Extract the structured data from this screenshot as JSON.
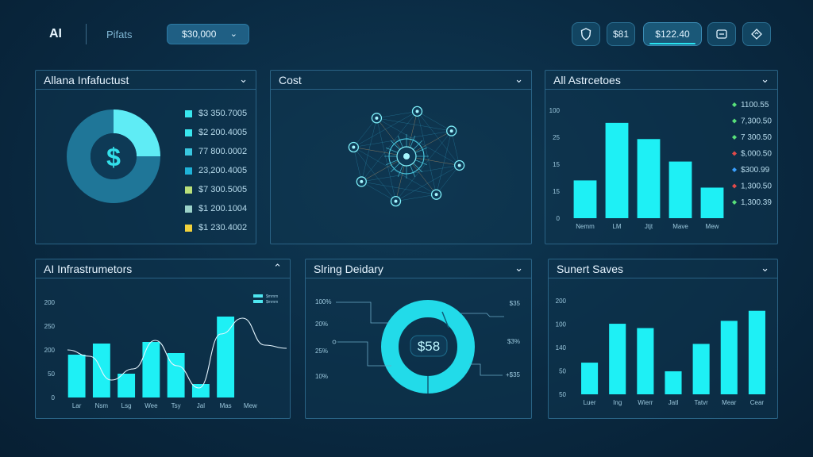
{
  "header": {
    "logo": "AI",
    "nav_label": "Pifats",
    "select_value": "$30,000",
    "buttons": [
      "$81",
      "$122.40"
    ],
    "icons": [
      "shield-icon",
      "card-icon",
      "navigation-icon"
    ]
  },
  "panels": {
    "infra": {
      "title": "Allana Infafuctust",
      "center_symbol": "$",
      "legend": [
        {
          "label": "$3 350.7005",
          "color": "#39e6ee"
        },
        {
          "label": "$2 200.4005",
          "color": "#39e6ee"
        },
        {
          "label": "77 800.0002",
          "color": "#39c7e0"
        },
        {
          "label": "23,200.4005",
          "color": "#1fb3d8"
        },
        {
          "label": "$7 300.5005",
          "color": "#b9e07a"
        },
        {
          "label": "$1 200.1004",
          "color": "#9bd2c8"
        },
        {
          "label": "$1 230.4002",
          "color": "#f2d23c"
        }
      ]
    },
    "cost": {
      "title": "Cost"
    },
    "assets": {
      "title": "All Astrcetoes",
      "legend": [
        {
          "label": "1100.55",
          "color": "#58e07a"
        },
        {
          "label": "7,300.50",
          "color": "#58e07a"
        },
        {
          "label": "7 300.50",
          "color": "#58e07a"
        },
        {
          "label": "$,000.50",
          "color": "#e04a4a"
        },
        {
          "label": "$300.99",
          "color": "#3aa0ff"
        },
        {
          "label": "1,300.50",
          "color": "#e04a4a"
        },
        {
          "label": "1,300.39",
          "color": "#58e07a"
        }
      ]
    },
    "infra2": {
      "title": "AI Infrastrumetors",
      "legend": [
        "$mmm",
        "$mmm"
      ]
    },
    "spending": {
      "title": "Slring Deidary",
      "center_value": "$58",
      "left_labels": [
        "100%",
        "20%",
        "25%",
        "10%"
      ],
      "right_labels": [
        "$35",
        "$3%",
        "+$35"
      ]
    },
    "sales": {
      "title": "Sunert Saves"
    }
  },
  "chart_data": [
    {
      "type": "pie",
      "title": "Allana Infafuctust",
      "values": [
        24,
        76
      ],
      "colors": [
        "#5fecf5",
        "#1f7698"
      ]
    },
    {
      "type": "bar",
      "title": "All Astrcetoes",
      "categories": [
        "Nemm",
        "LM",
        "Jtjt",
        "Mave",
        "Mew"
      ],
      "yticks": [
        "0",
        "15",
        "15",
        "25",
        "100"
      ],
      "values": [
        4.2,
        10.6,
        8.8,
        6.3,
        3.4
      ],
      "ylim": [
        0,
        12
      ],
      "color": "#1ef0f5"
    },
    {
      "type": "bar",
      "title": "AI Infrastrumetors",
      "categories": [
        "Lar",
        "Nsm",
        "Lsg",
        "Wee",
        "Tsy",
        "Jal",
        "Mas",
        "Mew"
      ],
      "yticks": [
        "0",
        "50",
        "200",
        "250",
        "200"
      ],
      "values": [
        2.7,
        3.4,
        1.5,
        3.5,
        2.8,
        0.85,
        5.1
      ],
      "line": [
        3.0,
        2.6,
        1.1,
        1.8,
        3.6,
        2.0,
        0.6,
        4.0,
        5.0,
        3.3,
        3.1
      ],
      "ylim": [
        0,
        6
      ],
      "color": "#1ef0f5"
    },
    {
      "type": "pie",
      "title": "Slring Deidary",
      "values": [
        55,
        45
      ],
      "colors": [
        "#27e0ee",
        "#19c8dc"
      ]
    },
    {
      "type": "bar",
      "title": "Sunert Saves",
      "categories": [
        "Luer",
        "Ing",
        "Wierr",
        "Jatl",
        "Tatvr",
        "Mear",
        "Cear"
      ],
      "yticks": [
        "50",
        "50",
        "140",
        "100",
        "200"
      ],
      "values": [
        2.2,
        4.9,
        4.6,
        1.6,
        3.5,
        5.1,
        5.8
      ],
      "ylim": [
        0,
        6.5
      ],
      "color": "#1ef0f5"
    }
  ]
}
